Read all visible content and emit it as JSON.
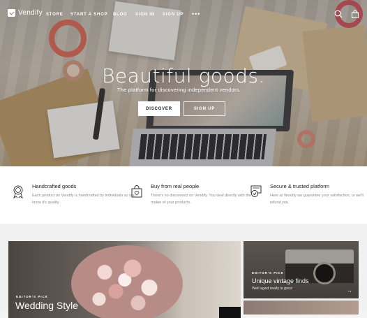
{
  "nav": {
    "logo": "Vendify",
    "links": [
      "STORE",
      "START A SHOP",
      "BLOG",
      "SIGN IN",
      "SIGN UP"
    ],
    "more": "•••",
    "icons": [
      "search-icon",
      "bag-icon"
    ]
  },
  "hero": {
    "title": "Beautiful goods.",
    "subtitle": "The platform for discovering independent vendors.",
    "discover_label": "DISCOVER",
    "signup_label": "SIGN UP"
  },
  "features": [
    {
      "icon": "ribbon-medal-icon",
      "title": "Handcrafted goods",
      "desc": "Each product on Vendify is handcrafted by individuals so you know it's quality."
    },
    {
      "icon": "shopping-bag-heart-icon",
      "title": "Buy from real people",
      "desc": "There's no disconnect on Vendify. You deal directly with the maker of your products."
    },
    {
      "icon": "secure-badge-icon",
      "title": "Secure & trusted platform",
      "desc": "Here at Vendify we guarantee your satisfaction, or we'll refund you."
    }
  ],
  "cards": {
    "big": {
      "eyebrow": "EDITOR'S PICK",
      "title": "Wedding Style"
    },
    "small": {
      "eyebrow": "EDITOR'S PICK",
      "title": "Unique vintage finds",
      "desc": "Well aged really is good",
      "arrow": "→"
    }
  },
  "colors": {
    "accent": "#222222",
    "feature_text": "#8a8a8a"
  }
}
